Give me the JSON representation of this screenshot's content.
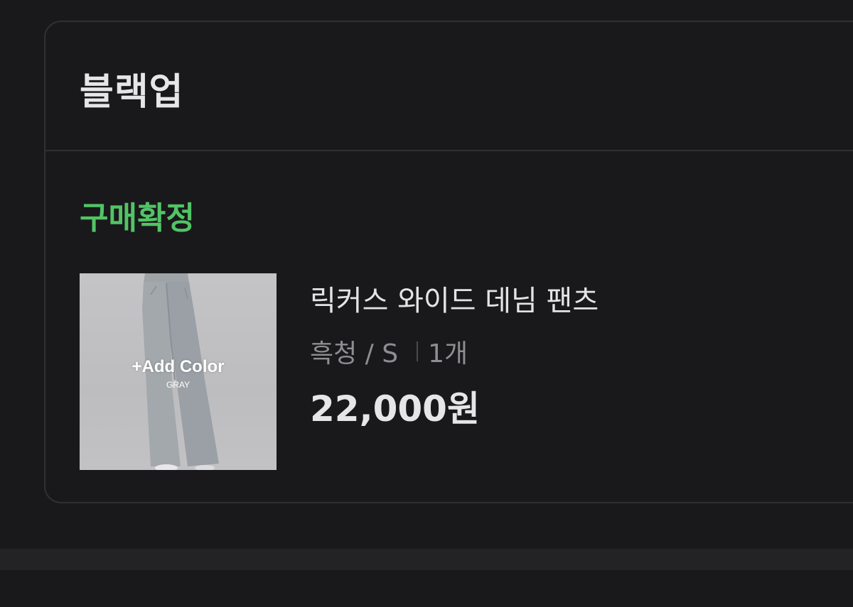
{
  "order": {
    "shop_name": "블랙업",
    "status": "구매확정",
    "status_color": "#52c466",
    "product": {
      "name": "릭커스 와이드 데님 팬츠",
      "option": "흑청 / S",
      "quantity": "1개",
      "price": "22,000원",
      "thumbnail": {
        "overlay_title": "+Add Color",
        "overlay_subtitle": "GRAY"
      }
    }
  }
}
